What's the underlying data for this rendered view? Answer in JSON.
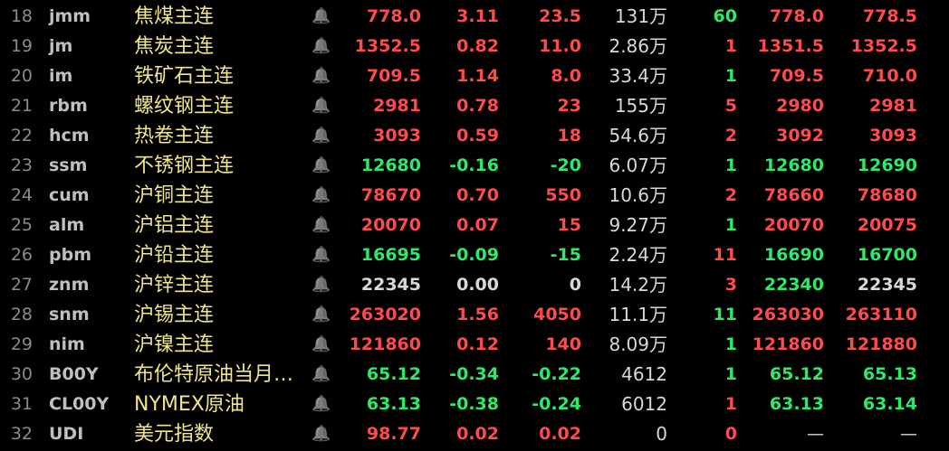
{
  "colors": {
    "up": "#ff4b4b",
    "down": "#2ee86a",
    "flat": "#d8d8d8",
    "name": "#f0e68c",
    "background": "#000000"
  },
  "bell_icon": "bell-icon",
  "rows": [
    {
      "idx": "18",
      "code": "jmm",
      "name": "焦煤主连",
      "last": "778.0",
      "chg": "3.11",
      "chgamt": "23.5",
      "vol": "131万",
      "cnt": "60",
      "bid": "778.0",
      "ask": "778.5",
      "dir": "up",
      "cnt_dir": "down"
    },
    {
      "idx": "19",
      "code": "jm",
      "name": "焦炭主连",
      "last": "1352.5",
      "chg": "0.82",
      "chgamt": "11.0",
      "vol": "2.86万",
      "cnt": "1",
      "bid": "1351.5",
      "ask": "1352.5",
      "dir": "up",
      "cnt_dir": "up"
    },
    {
      "idx": "20",
      "code": "im",
      "name": "铁矿石主连",
      "last": "709.5",
      "chg": "1.14",
      "chgamt": "8.0",
      "vol": "33.4万",
      "cnt": "1",
      "bid": "709.5",
      "ask": "710.0",
      "dir": "up",
      "cnt_dir": "down"
    },
    {
      "idx": "21",
      "code": "rbm",
      "name": "螺纹钢主连",
      "last": "2981",
      "chg": "0.78",
      "chgamt": "23",
      "vol": "155万",
      "cnt": "5",
      "bid": "2980",
      "ask": "2981",
      "dir": "up",
      "cnt_dir": "up"
    },
    {
      "idx": "22",
      "code": "hcm",
      "name": "热卷主连",
      "last": "3093",
      "chg": "0.59",
      "chgamt": "18",
      "vol": "54.6万",
      "cnt": "2",
      "bid": "3092",
      "ask": "3093",
      "dir": "up",
      "cnt_dir": "up"
    },
    {
      "idx": "23",
      "code": "ssm",
      "name": "不锈钢主连",
      "last": "12680",
      "chg": "-0.16",
      "chgamt": "-20",
      "vol": "6.07万",
      "cnt": "1",
      "bid": "12680",
      "ask": "12690",
      "dir": "down",
      "cnt_dir": "down"
    },
    {
      "idx": "24",
      "code": "cum",
      "name": "沪铜主连",
      "last": "78670",
      "chg": "0.70",
      "chgamt": "550",
      "vol": "10.6万",
      "cnt": "2",
      "bid": "78660",
      "ask": "78680",
      "dir": "up",
      "cnt_dir": "up"
    },
    {
      "idx": "25",
      "code": "alm",
      "name": "沪铝主连",
      "last": "20070",
      "chg": "0.07",
      "chgamt": "15",
      "vol": "9.27万",
      "cnt": "1",
      "bid": "20070",
      "ask": "20075",
      "dir": "up",
      "cnt_dir": "down"
    },
    {
      "idx": "26",
      "code": "pbm",
      "name": "沪铅主连",
      "last": "16695",
      "chg": "-0.09",
      "chgamt": "-15",
      "vol": "2.24万",
      "cnt": "11",
      "bid": "16690",
      "ask": "16700",
      "dir": "down",
      "cnt_dir": "up"
    },
    {
      "idx": "27",
      "code": "znm",
      "name": "沪锌主连",
      "last": "22345",
      "chg": "0.00",
      "chgamt": "0",
      "vol": "14.2万",
      "cnt": "3",
      "bid": "22340",
      "ask": "22345",
      "dir": "flat",
      "cnt_dir": "up",
      "bid_dir": "down"
    },
    {
      "idx": "28",
      "code": "snm",
      "name": "沪锡主连",
      "last": "263020",
      "chg": "1.56",
      "chgamt": "4050",
      "vol": "11.1万",
      "cnt": "11",
      "bid": "263030",
      "ask": "263110",
      "dir": "up",
      "cnt_dir": "down"
    },
    {
      "idx": "29",
      "code": "nim",
      "name": "沪镍主连",
      "last": "121860",
      "chg": "0.12",
      "chgamt": "140",
      "vol": "8.09万",
      "cnt": "1",
      "bid": "121860",
      "ask": "121880",
      "dir": "up",
      "cnt_dir": "down"
    },
    {
      "idx": "30",
      "code": "B00Y",
      "name": "布伦特原油当月连续",
      "last": "65.12",
      "chg": "-0.34",
      "chgamt": "-0.22",
      "vol": "4612",
      "cnt": "1",
      "bid": "65.12",
      "ask": "65.13",
      "dir": "down",
      "cnt_dir": "down"
    },
    {
      "idx": "31",
      "code": "CL00Y",
      "name": "NYMEX原油",
      "last": "63.13",
      "chg": "-0.38",
      "chgamt": "-0.24",
      "vol": "6012",
      "cnt": "1",
      "bid": "63.13",
      "ask": "63.14",
      "dir": "down",
      "cnt_dir": "up"
    },
    {
      "idx": "32",
      "code": "UDI",
      "name": "美元指数",
      "last": "98.77",
      "chg": "0.02",
      "chgamt": "0.02",
      "vol": "0",
      "cnt": "0",
      "bid": "—",
      "ask": "—",
      "dir": "up",
      "cnt_dir": "up",
      "bid_dir": "dash",
      "ask_dir": "dash"
    }
  ]
}
